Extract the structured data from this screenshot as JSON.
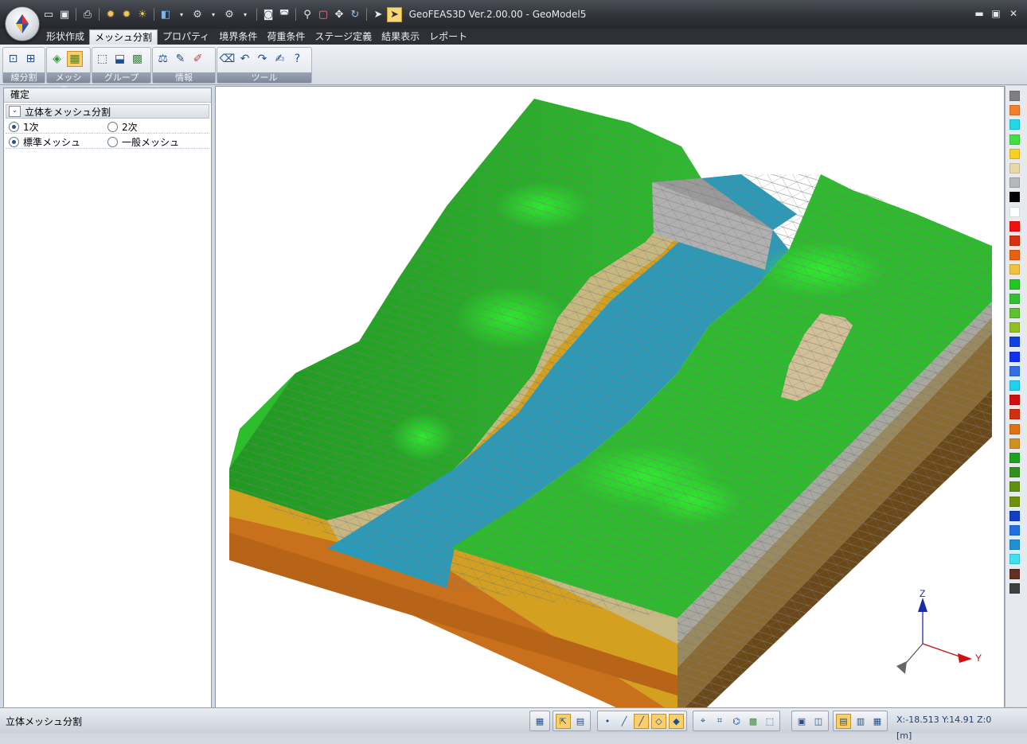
{
  "app": {
    "title": "GeoFEAS3D Ver.2.00.00 - GeoModel5"
  },
  "window_controls": {
    "minimize": "▬",
    "maximize": "▣",
    "close": "✕"
  },
  "menu": {
    "tabs": [
      "形状作成",
      "メッシュ分割",
      "プロパティ",
      "境界条件",
      "荷重条件",
      "ステージ定義",
      "結果表示",
      "レポート"
    ],
    "selected": "メッシュ分割"
  },
  "ribbon": {
    "groups": [
      {
        "label": "線分割",
        "icons": [
          "line-split-icon",
          "line-split-alt-icon"
        ]
      },
      {
        "label": "メッシュ...",
        "icons": [
          "mesh-surface-icon",
          "mesh-solid-icon"
        ]
      },
      {
        "label": "グループ",
        "icons": [
          "group-select-icon",
          "group-frame-icon",
          "group-fill-icon"
        ]
      },
      {
        "label": "情報",
        "icons": [
          "node-info-icon",
          "element-info-icon",
          "picker-icon"
        ]
      },
      {
        "label": "ツール",
        "icons": [
          "eraser-icon",
          "undo-icon",
          "redo-icon",
          "edit-icon",
          "help-icon"
        ]
      }
    ],
    "active_icon": "mesh-solid-icon"
  },
  "panel": {
    "header": "確定",
    "section_title": "立体をメッシュ分割",
    "order_options": [
      "1次",
      "2次"
    ],
    "order_selected": "1次",
    "mesh_type_options": [
      "標準メッシュ",
      "一般メッシュ"
    ],
    "mesh_type_selected": "標準メッシュ"
  },
  "viewport": {
    "axis_labels": {
      "z": "Z",
      "y": "Y"
    }
  },
  "palette": {
    "colors": [
      "#7f7f7f",
      "#f08030",
      "#20d8e8",
      "#40e040",
      "#f8d020",
      "#e8d8a8",
      "#b8b8b8",
      "#000000",
      "#ffffff",
      "#f01010",
      "#d83010",
      "#e86010",
      "#f0c040",
      "#20c820",
      "#30c030",
      "#60c030",
      "#90c020",
      "#1040e0",
      "#1030f0",
      "#3070e0",
      "#20d0f0",
      "#d01010",
      "#d03010",
      "#e07010",
      "#d09020",
      "#20a020",
      "#309020",
      "#609010",
      "#709010",
      "#1040c0",
      "#2070e0",
      "#2090d0",
      "#40e0f0",
      "#603020",
      "#404040"
    ]
  },
  "status": {
    "text": "立体メッシュ分割",
    "coords": "X:-18.513  Y:14.91  Z:0  [m]"
  }
}
